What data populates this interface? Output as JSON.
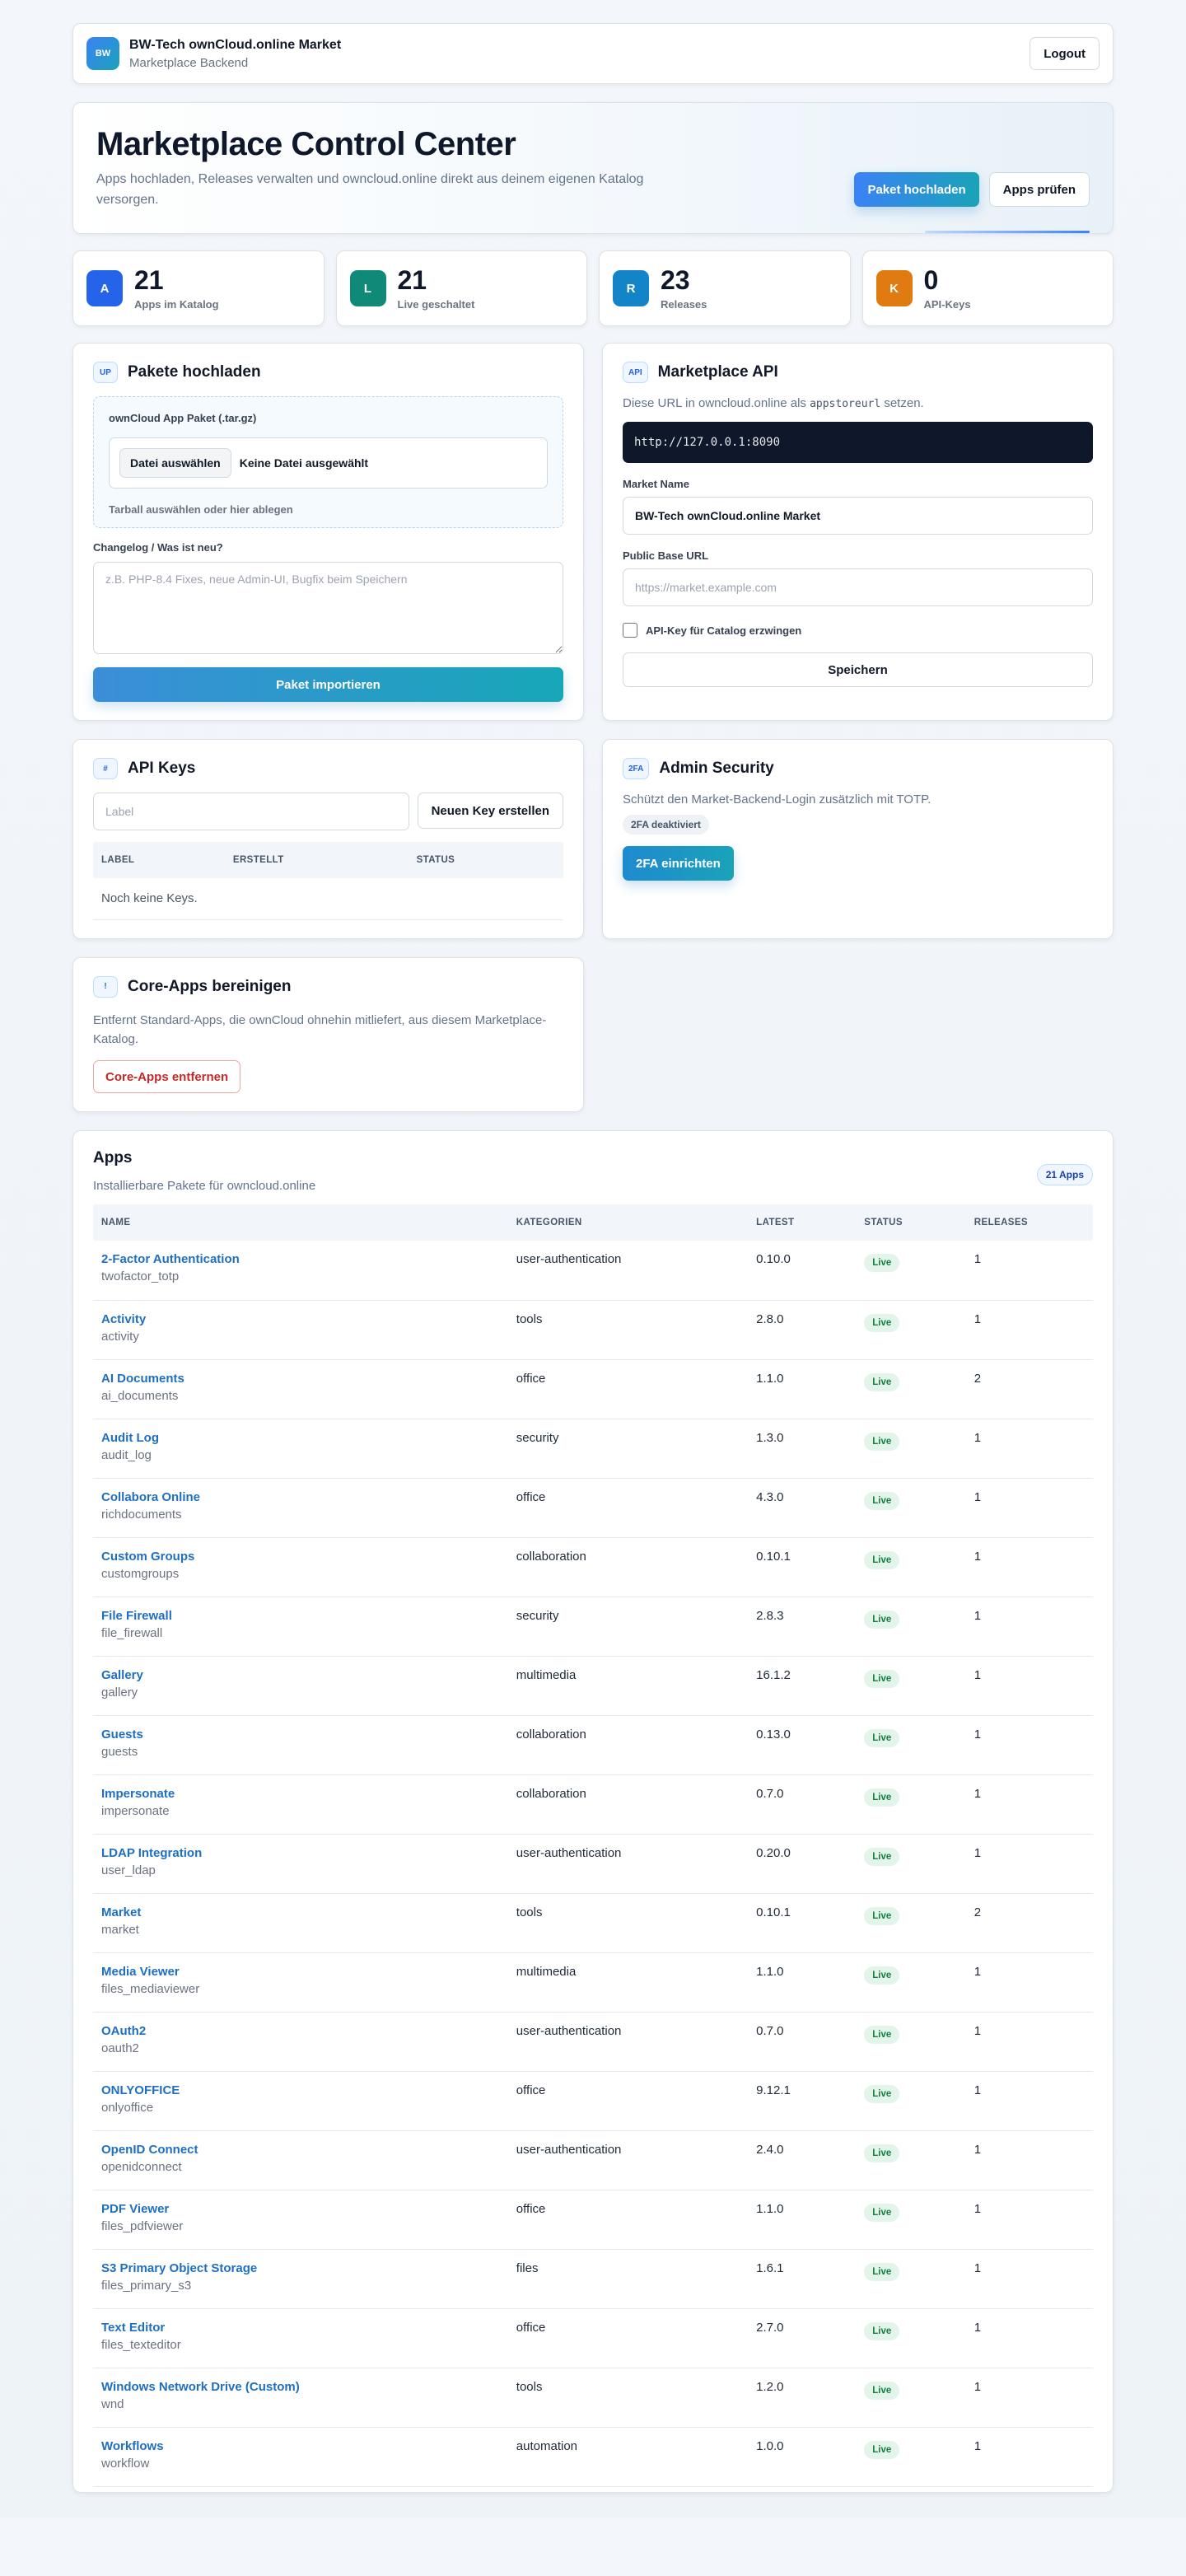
{
  "topbar": {
    "logo_text": "BW",
    "title": "BW-Tech ownCloud.online Market",
    "subtitle": "Marketplace Backend",
    "logout_label": "Logout"
  },
  "hero": {
    "title": "Marketplace Control Center",
    "description": "Apps hochladen, Releases verwalten und owncloud.online direkt aus deinem eigenen Katalog versorgen.",
    "upload_label": "Paket hochladen",
    "check_label": "Apps prüfen"
  },
  "stats": [
    {
      "icon": "A",
      "value": "21",
      "label": "Apps im Katalog",
      "color": "#2563eb"
    },
    {
      "icon": "L",
      "value": "21",
      "label": "Live geschaltet",
      "color": "#0f8a78"
    },
    {
      "icon": "R",
      "value": "23",
      "label": "Releases",
      "color": "#1284c8"
    },
    {
      "icon": "K",
      "value": "0",
      "label": "API-Keys",
      "color": "#e07b12"
    }
  ],
  "upload": {
    "badge": "UP",
    "title": "Pakete hochladen",
    "file_label": "ownCloud App Paket (.tar.gz)",
    "choose_label": "Datei auswählen",
    "no_file": "Keine Datei ausgewählt",
    "hint": "Tarball auswählen oder hier ablegen",
    "changelog_label": "Changelog / Was ist neu?",
    "changelog_placeholder": "z.B. PHP-8.4 Fixes, neue Admin-UI, Bugfix beim Speichern",
    "import_label": "Paket importieren"
  },
  "api": {
    "badge": "API",
    "title": "Marketplace API",
    "desc_before": "Diese URL in owncloud.online als",
    "desc_code": "appstoreurl",
    "desc_after": "setzen.",
    "url": "http://127.0.0.1:8090",
    "market_name_label": "Market Name",
    "market_name_value": "BW-Tech ownCloud.online Market",
    "base_url_label": "Public Base URL",
    "base_url_placeholder": "https://market.example.com",
    "force_key_label": "API-Key für Catalog erzwingen",
    "save_label": "Speichern"
  },
  "keys": {
    "badge": "#",
    "title": "API Keys",
    "label_placeholder": "Label",
    "new_key_label": "Neuen Key erstellen",
    "columns": [
      "LABEL",
      "ERSTELLT",
      "STATUS"
    ],
    "empty": "Noch keine Keys."
  },
  "security": {
    "badge": "2FA",
    "title": "Admin Security",
    "description": "Schützt den Market-Backend-Login zusätzlich mit TOTP.",
    "status": "2FA deaktiviert",
    "setup_label": "2FA einrichten"
  },
  "core": {
    "badge": "!",
    "title": "Core-Apps bereinigen",
    "description": "Entfernt Standard-Apps, die ownCloud ohnehin mitliefert, aus diesem Marketplace-Katalog.",
    "remove_label": "Core-Apps entfernen"
  },
  "apps": {
    "title": "Apps",
    "subtitle": "Installierbare Pakete für owncloud.online",
    "count": "21 Apps",
    "columns": [
      "NAME",
      "KATEGORIEN",
      "LATEST",
      "STATUS",
      "RELEASES"
    ],
    "rows": [
      {
        "name": "2-Factor Authentication",
        "id": "twofactor_totp",
        "category": "user-authentication",
        "latest": "0.10.0",
        "status": "Live",
        "releases": "1"
      },
      {
        "name": "Activity",
        "id": "activity",
        "category": "tools",
        "latest": "2.8.0",
        "status": "Live",
        "releases": "1"
      },
      {
        "name": "AI Documents",
        "id": "ai_documents",
        "category": "office",
        "latest": "1.1.0",
        "status": "Live",
        "releases": "2"
      },
      {
        "name": "Audit Log",
        "id": "audit_log",
        "category": "security",
        "latest": "1.3.0",
        "status": "Live",
        "releases": "1"
      },
      {
        "name": "Collabora Online",
        "id": "richdocuments",
        "category": "office",
        "latest": "4.3.0",
        "status": "Live",
        "releases": "1"
      },
      {
        "name": "Custom Groups",
        "id": "customgroups",
        "category": "collaboration",
        "latest": "0.10.1",
        "status": "Live",
        "releases": "1"
      },
      {
        "name": "File Firewall",
        "id": "file_firewall",
        "category": "security",
        "latest": "2.8.3",
        "status": "Live",
        "releases": "1"
      },
      {
        "name": "Gallery",
        "id": "gallery",
        "category": "multimedia",
        "latest": "16.1.2",
        "status": "Live",
        "releases": "1"
      },
      {
        "name": "Guests",
        "id": "guests",
        "category": "collaboration",
        "latest": "0.13.0",
        "status": "Live",
        "releases": "1"
      },
      {
        "name": "Impersonate",
        "id": "impersonate",
        "category": "collaboration",
        "latest": "0.7.0",
        "status": "Live",
        "releases": "1"
      },
      {
        "name": "LDAP Integration",
        "id": "user_ldap",
        "category": "user-authentication",
        "latest": "0.20.0",
        "status": "Live",
        "releases": "1"
      },
      {
        "name": "Market",
        "id": "market",
        "category": "tools",
        "latest": "0.10.1",
        "status": "Live",
        "releases": "2"
      },
      {
        "name": "Media Viewer",
        "id": "files_mediaviewer",
        "category": "multimedia",
        "latest": "1.1.0",
        "status": "Live",
        "releases": "1"
      },
      {
        "name": "OAuth2",
        "id": "oauth2",
        "category": "user-authentication",
        "latest": "0.7.0",
        "status": "Live",
        "releases": "1"
      },
      {
        "name": "ONLYOFFICE",
        "id": "onlyoffice",
        "category": "office",
        "latest": "9.12.1",
        "status": "Live",
        "releases": "1"
      },
      {
        "name": "OpenID Connect",
        "id": "openidconnect",
        "category": "user-authentication",
        "latest": "2.4.0",
        "status": "Live",
        "releases": "1"
      },
      {
        "name": "PDF Viewer",
        "id": "files_pdfviewer",
        "category": "office",
        "latest": "1.1.0",
        "status": "Live",
        "releases": "1"
      },
      {
        "name": "S3 Primary Object Storage",
        "id": "files_primary_s3",
        "category": "files",
        "latest": "1.6.1",
        "status": "Live",
        "releases": "1"
      },
      {
        "name": "Text Editor",
        "id": "files_texteditor",
        "category": "office",
        "latest": "2.7.0",
        "status": "Live",
        "releases": "1"
      },
      {
        "name": "Windows Network Drive (Custom)",
        "id": "wnd",
        "category": "tools",
        "latest": "1.2.0",
        "status": "Live",
        "releases": "1"
      },
      {
        "name": "Workflows",
        "id": "workflow",
        "category": "automation",
        "latest": "1.0.0",
        "status": "Live",
        "releases": "1"
      }
    ]
  }
}
